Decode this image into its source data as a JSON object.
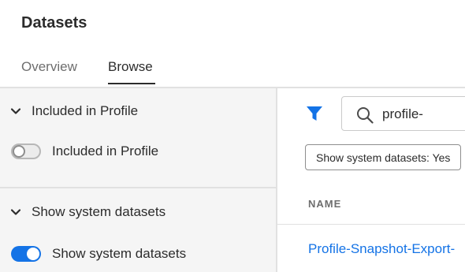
{
  "header": {
    "title": "Datasets"
  },
  "tabs": [
    {
      "label": "Overview",
      "active": false
    },
    {
      "label": "Browse",
      "active": true
    }
  ],
  "sidebar": {
    "sections": [
      {
        "header": "Included in Profile",
        "toggle_label": "Included in Profile",
        "toggle_on": false
      },
      {
        "header": "Show system datasets",
        "toggle_label": "Show system datasets",
        "toggle_on": true
      }
    ]
  },
  "toolbar": {
    "search": {
      "value": "profile-",
      "placeholder": ""
    },
    "filter_tag": "Show system datasets: Yes"
  },
  "table": {
    "columns": [
      "NAME"
    ],
    "rows": [
      {
        "name": "Profile-Snapshot-Export-"
      }
    ]
  },
  "colors": {
    "accent": "#1473e6",
    "sidebar_bg": "#f5f5f5",
    "text": "#2c2c2c",
    "muted": "#6e6e6e"
  },
  "icons": {
    "filter": "filter-icon",
    "search": "search-icon",
    "chevron": "chevron-down-icon"
  }
}
